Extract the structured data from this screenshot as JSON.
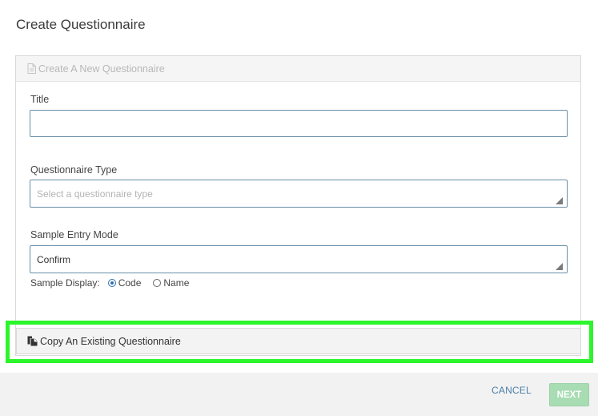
{
  "dialog": {
    "title": "Create Questionnaire"
  },
  "new_panel": {
    "header_label": "Create A New Questionnaire",
    "header_icon": "document-icon",
    "title_label": "Title",
    "title_value": "",
    "type_label": "Questionnaire Type",
    "type_placeholder": "Select a questionnaire type",
    "entry_mode_label": "Sample Entry Mode",
    "entry_mode_value": "Confirm",
    "sample_display_label": "Sample Display:",
    "sample_display_options": [
      {
        "label": "Code",
        "checked": true
      },
      {
        "label": "Name",
        "checked": false
      }
    ]
  },
  "copy_panel": {
    "header_label": "Copy An Existing Questionnaire",
    "header_icon": "copy-icon",
    "highlight_color": "#2cf52c"
  },
  "footer": {
    "cancel_label": "CANCEL",
    "next_label": "NEXT",
    "next_enabled": false
  }
}
